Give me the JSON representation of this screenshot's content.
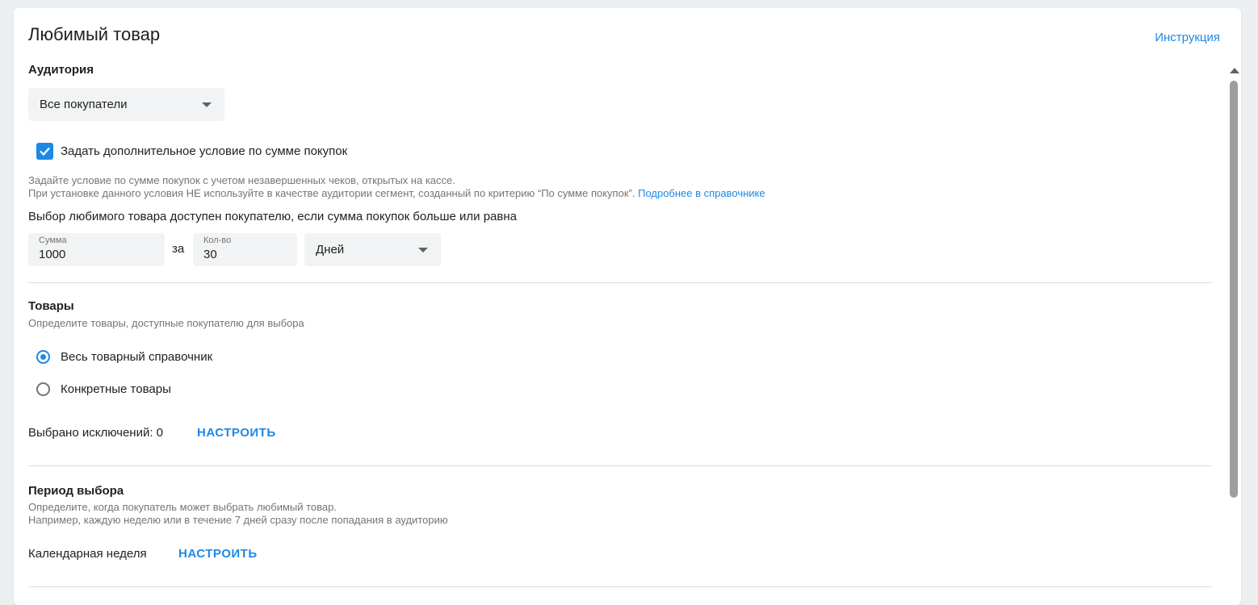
{
  "header": {
    "title": "Любимый товар",
    "help_link": "Инструкция"
  },
  "audience": {
    "label": "Аудитория",
    "select_value": "Все покупатели",
    "checkbox_checked": true,
    "checkbox_label": "Задать дополнительное условие по сумме покупок",
    "hint_line1": "Задайте условие по сумме покупок с учетом незавершенных чеков, открытых на кассе.",
    "hint_line2": "При установке данного условия НЕ используйте в качестве аудитории сегмент, созданный по критерию “По сумме покупок”.",
    "hint_link": "Подробнее в справочнике",
    "condition_text": "Выбор любимого товара доступен покупателю, если сумма покупок больше или равна",
    "amount_label": "Сумма",
    "amount_value": "1000",
    "for_text": "за",
    "count_label": "Кол-во",
    "count_value": "30",
    "period_unit": "Дней"
  },
  "products": {
    "label": "Товары",
    "subtitle": "Определите товары, доступные покупателю для выбора",
    "options": [
      "Весь товарный справочник",
      "Конкретные товары"
    ],
    "selected_index": 0,
    "exclusions_text": "Выбрано исключений: 0",
    "configure_label": "НАСТРОИТЬ"
  },
  "period": {
    "label": "Период выбора",
    "hint_line1": "Определите, когда покупатель может выбрать любимый товар.",
    "hint_line2": "Например, каждую неделю или в течение 7 дней сразу после попадания в аудиторию",
    "value": "Календарная неделя",
    "configure_label": "НАСТРОИТЬ"
  },
  "colors": {
    "accent": "#1e88e5",
    "background": "#eceff1",
    "field_bg": "#f1f3f4"
  }
}
